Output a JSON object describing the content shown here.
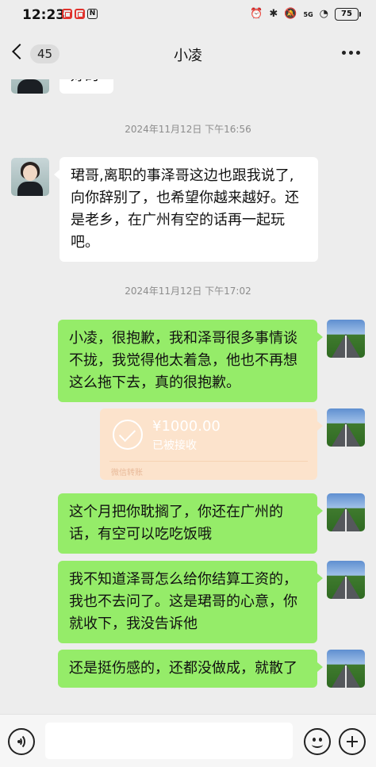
{
  "status_bar": {
    "time": "12:23",
    "network": "5G",
    "battery": "75"
  },
  "header": {
    "unread_count": "45",
    "title": "小凌"
  },
  "messages": [
    {
      "type": "incoming",
      "text": "好的"
    },
    {
      "type": "timestamp",
      "text": "2024年11月12日 下午16:56"
    },
    {
      "type": "incoming",
      "text": "珺哥,离职的事泽哥这边也跟我说了,向你辞别了，也希望你越来越好。还是老乡，在广州有空的话再一起玩吧。"
    },
    {
      "type": "timestamp",
      "text": "2024年11月12日 下午17:02"
    },
    {
      "type": "outgoing",
      "text": "小凌，很抱歉，我和泽哥很多事情谈不拢，我觉得他太着急，他也不再想这么拖下去，真的很抱歉。"
    },
    {
      "type": "transfer",
      "amount": "¥1000.00",
      "status": "已被接收",
      "label": "微信转账"
    },
    {
      "type": "outgoing",
      "text": "这个月把你耽搁了，你还在广州的话，有空可以吃吃饭哦"
    },
    {
      "type": "outgoing",
      "text": "我不知道泽哥怎么给你结算工资的，我也不去问了。这是珺哥的心意，你就收下，我没告诉他"
    },
    {
      "type": "outgoing",
      "text": "还是挺伤感的，还都没做成，就散了"
    }
  ],
  "colors": {
    "background": "#ededed",
    "outgoing_bubble": "#95ec69",
    "incoming_bubble": "#ffffff",
    "transfer_bubble": "#fce3cc"
  }
}
